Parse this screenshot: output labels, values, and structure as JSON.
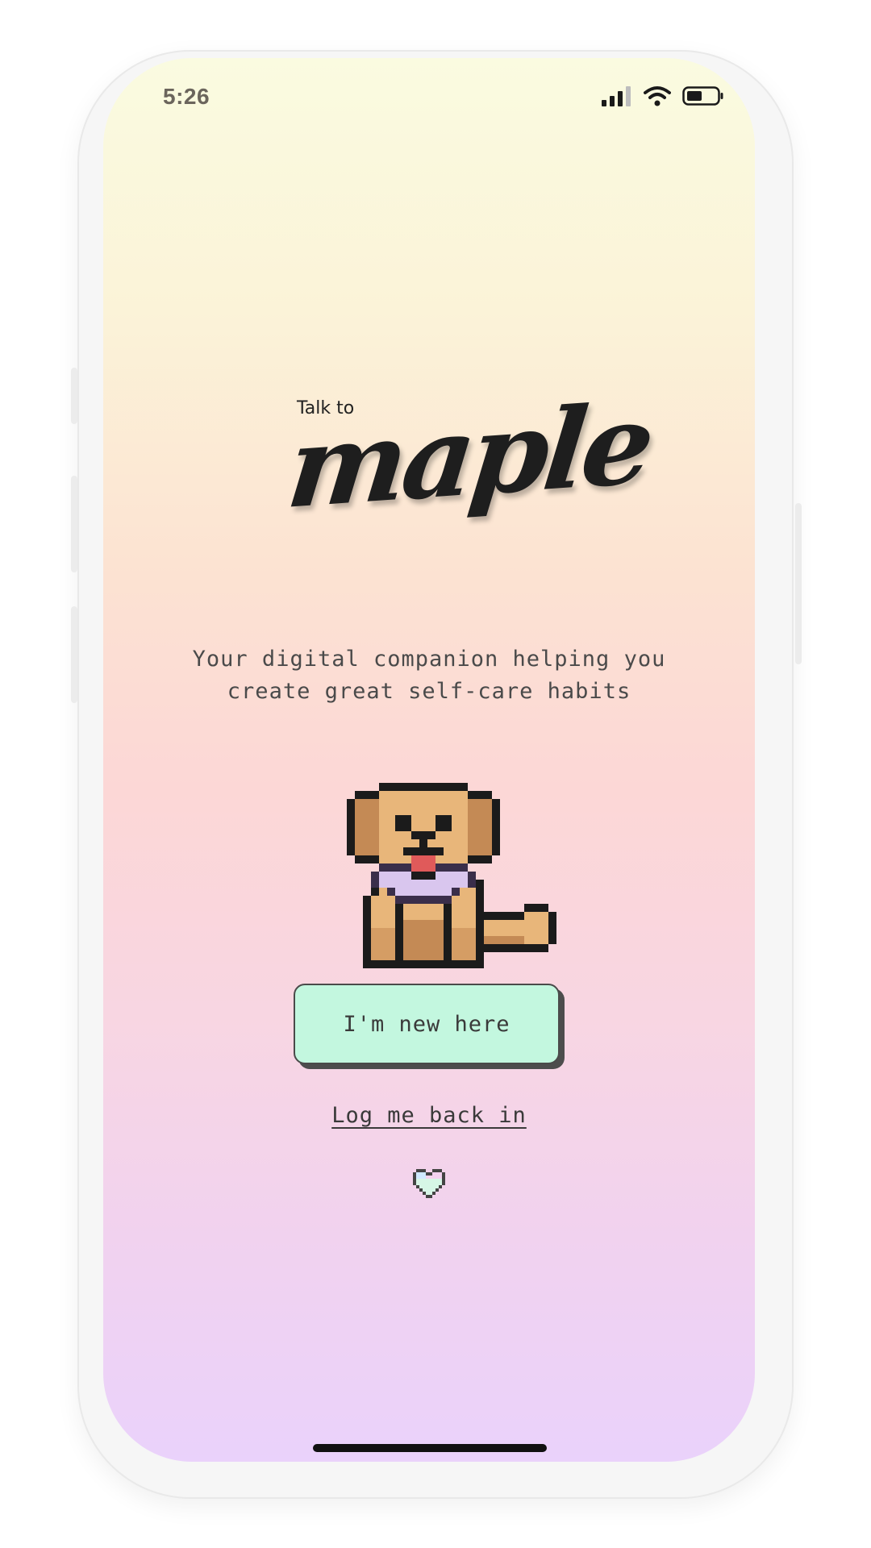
{
  "status_bar": {
    "time": "5:26"
  },
  "logo": {
    "prefix": "Talk to",
    "name": "maple"
  },
  "tagline": {
    "line1": "Your digital companion helping you",
    "line2": "create great self-care habits"
  },
  "actions": {
    "new_user_label": "I'm new here",
    "login_label": "Log me back in"
  },
  "colors": {
    "button_bg": "#c3f7df",
    "gradient_top": "#fafbe0",
    "gradient_bottom": "#ead2fb",
    "text": "#3a3a3a"
  },
  "icons": {
    "mascot": "pixel-dog-icon",
    "footer": "heart-icon"
  }
}
